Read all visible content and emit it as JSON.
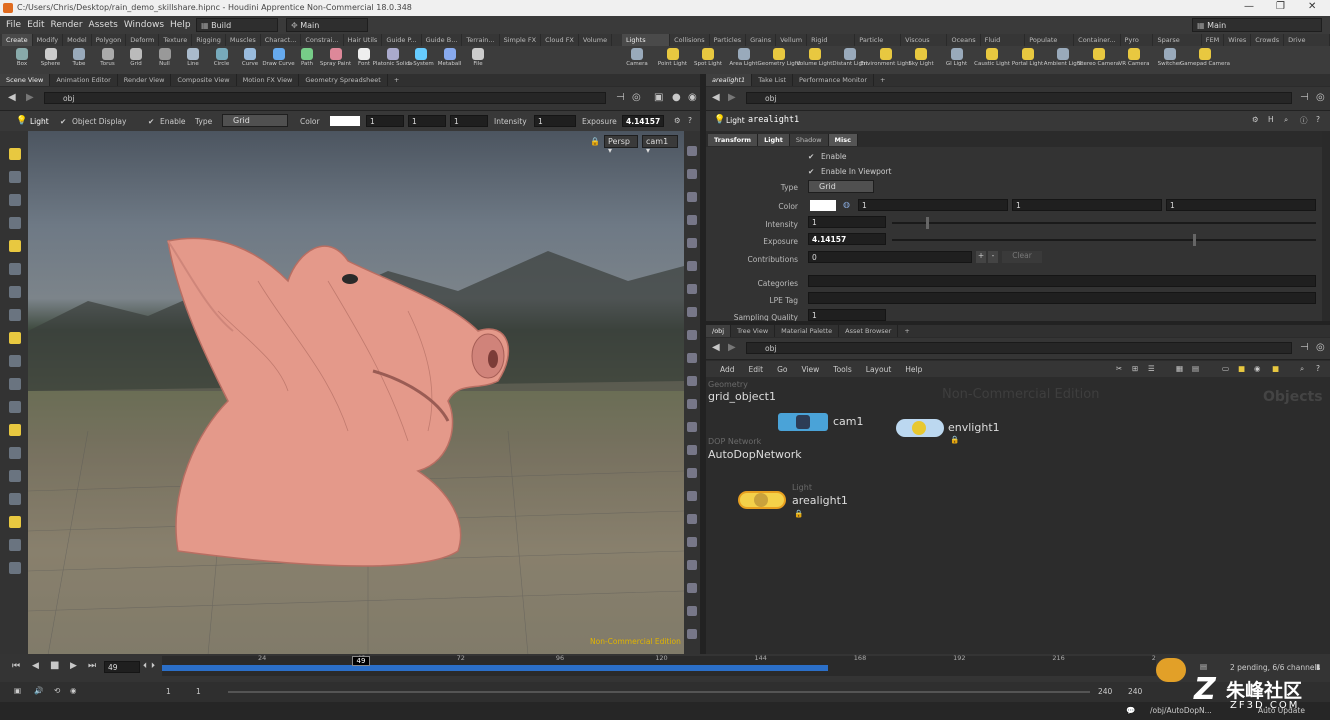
{
  "window": {
    "title": "C:/Users/Chris/Desktop/rain_demo_skillshare.hipnc - Houdini Apprentice Non-Commercial 18.0.348",
    "minimize": "—",
    "restore": "❐",
    "close": "✕"
  },
  "menu": {
    "items": [
      "File",
      "Edit",
      "Render",
      "Assets",
      "Windows",
      "Help"
    ],
    "desktop": "Build",
    "context": "Main",
    "right_desktop": "Main"
  },
  "shelf_tabs_left": [
    "Create",
    "Modify",
    "Model",
    "Polygon",
    "Deform",
    "Texture",
    "Rigging",
    "Muscles",
    "Charact...",
    "Constrai...",
    "Hair Utils",
    "Guide P...",
    "Guide B...",
    "Terrain...",
    "Simple FX",
    "Cloud FX",
    "Volume"
  ],
  "shelf_tabs_right": [
    "Lights and...",
    "Collisions",
    "Particles",
    "Grains",
    "Vellum",
    "Rigid Bodies",
    "Particle Fl...",
    "Viscous Fl...",
    "Oceans",
    "Fluid Con...",
    "Populate C...",
    "Container...",
    "Pyro FX",
    "Sparse Pyr...",
    "FEM",
    "Wires",
    "Crowds",
    "Drive Sim..."
  ],
  "tools_left": [
    "Box",
    "Sphere",
    "Tube",
    "Torus",
    "Grid",
    "Null",
    "Line",
    "Circle",
    "Curve",
    "Draw Curve",
    "Path",
    "Spray Paint",
    "Font",
    "Platonic Solids",
    "L-System",
    "Metaball",
    "File"
  ],
  "tools_right": [
    "Camera",
    "Point Light",
    "Spot Light",
    "Area Light",
    "Geometry Light",
    "Volume Light",
    "Distant Light",
    "Environment Light",
    "Sky Light",
    "GI Light",
    "Caustic Light",
    "Portal Light",
    "Ambient Light",
    "Stereo Camera",
    "VR Camera",
    "Switcher",
    "Gamepad Camera"
  ],
  "left_panel": {
    "tabs": [
      "Scene View",
      "Animation Editor",
      "Render View",
      "Composite View",
      "Motion FX View",
      "Geometry Spreadsheet"
    ],
    "path": "obj",
    "light_bar": {
      "mode": "Light",
      "object_display": "Object Display",
      "enable": "Enable",
      "type_label": "Type",
      "type_value": "Grid",
      "color_label": "Color",
      "c1": "1",
      "c2": "1",
      "c3": "1",
      "intensity_label": "Intensity",
      "intensity_value": "1",
      "exposure_label": "Exposure",
      "exposure_value": "4.14157"
    },
    "viewport": {
      "persp": "Persp",
      "camera": "cam1",
      "watermark": "Non-Commercial Edition"
    }
  },
  "param_panel": {
    "tabs": [
      "arealight1",
      "Take List",
      "Performance Monitor"
    ],
    "path": "obj",
    "node_type": "Light",
    "node_name": "arealight1",
    "subtabs": [
      "Transform",
      "Light",
      "Shadow",
      "Misc"
    ],
    "enable": "Enable",
    "enable_viewport": "Enable In Viewport",
    "type_label": "Type",
    "type_value": "Grid",
    "color_label": "Color",
    "c1": "1",
    "c2": "1",
    "c3": "1",
    "intensity_label": "Intensity",
    "intensity_value": "1",
    "exposure_label": "Exposure",
    "exposure_value": "4.14157",
    "contributions_label": "Contributions",
    "contributions_value": "0",
    "plus": "+",
    "minus": "-",
    "clear": "Clear",
    "categories_label": "Categories",
    "lpe_label": "LPE Tag",
    "sampling_label": "Sampling Quality",
    "sampling_value": "1",
    "intensity_level": 0.08,
    "exposure_level": 0.71
  },
  "network_panel": {
    "tabs": [
      "/obj",
      "Tree View",
      "Material Palette",
      "Asset Browser"
    ],
    "path": "obj",
    "menu": [
      "Add",
      "Edit",
      "Go",
      "View",
      "Tools",
      "Layout",
      "Help"
    ],
    "watermark": "Non-Commercial Edition",
    "context_label": "Objects",
    "nodes": {
      "geo_type": "Geometry",
      "geo_name": "grid_object1",
      "cam": "cam1",
      "env": "envlight1",
      "dop_type": "DOP Network",
      "dop_name": "AutoDopNetwork",
      "light_type": "Light",
      "light_name": "arealight1"
    }
  },
  "timeline": {
    "current_frame": "49",
    "playhead_label": "49",
    "ticks": [
      "24",
      "48",
      "72",
      "96",
      "120",
      "144",
      "168",
      "192",
      "216",
      "2"
    ],
    "range_start": "1",
    "range_start2": "1",
    "range_end": "240",
    "range_end2": "240",
    "status": "2 pending, 6/6 channels",
    "cache_fraction": 0.41
  },
  "statusbar": {
    "path": "/obj/AutoDopN...",
    "mode": "Auto Update"
  },
  "overlay": {
    "brand": "朱峰社区",
    "site": "ZF3D.COM"
  }
}
